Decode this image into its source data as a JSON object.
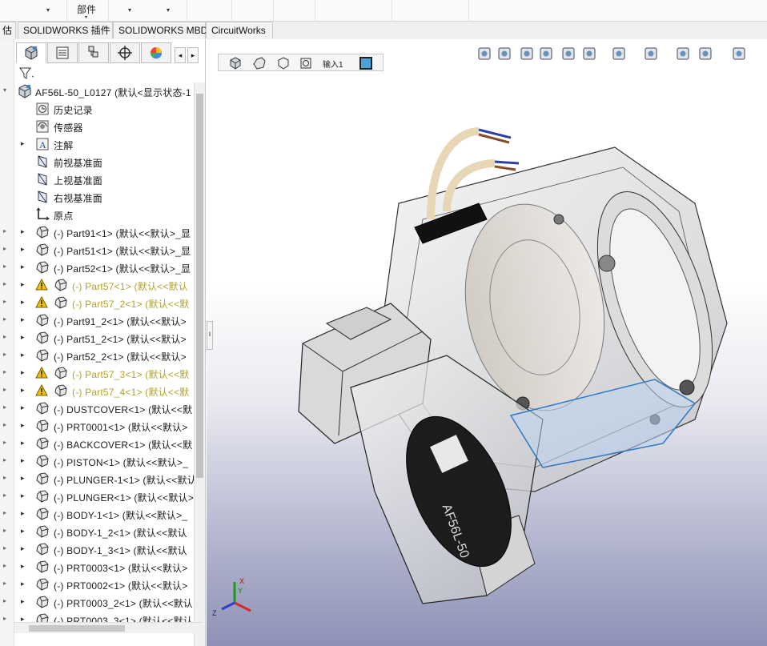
{
  "ribbon": {
    "groups": [
      {
        "label": "",
        "caret": "▾"
      },
      {
        "label": "部件",
        "caret": "▾"
      },
      {
        "label": "",
        "caret": "▾"
      },
      {
        "label": "",
        "caret": ""
      },
      {
        "label": "",
        "caret": ""
      },
      {
        "label": "",
        "caret": ""
      },
      {
        "label": "",
        "caret": ""
      },
      {
        "label": "",
        "caret": ""
      }
    ]
  },
  "tabs": [
    {
      "label": "估"
    },
    {
      "label": "SOLIDWORKS 插件"
    },
    {
      "label": "SOLIDWORKS MBD"
    },
    {
      "label": "CircuitWorks"
    }
  ],
  "panel_tabs": [
    {
      "icon": "feature-manager-icon"
    },
    {
      "icon": "property-manager-icon"
    },
    {
      "icon": "configuration-manager-icon"
    },
    {
      "icon": "dimxpert-icon"
    },
    {
      "icon": "display-manager-icon"
    }
  ],
  "tree": {
    "root": "AF56L-50_L0127  (默认<显示状态-1",
    "fixed_items": [
      {
        "label": "历史记录",
        "icon": "history-icon"
      },
      {
        "label": "传感器",
        "icon": "sensor-icon"
      },
      {
        "label": "注解",
        "icon": "annotation-icon"
      },
      {
        "label": "前视基准面",
        "icon": "plane-icon"
      },
      {
        "label": "上视基准面",
        "icon": "plane-icon"
      },
      {
        "label": "右视基准面",
        "icon": "plane-icon"
      },
      {
        "label": "原点",
        "icon": "origin-icon"
      }
    ],
    "parts": [
      {
        "label": "(-) Part91<1> (默认<<默认>_显",
        "warning": false
      },
      {
        "label": "(-) Part51<1> (默认<<默认>_显",
        "warning": false
      },
      {
        "label": "(-) Part52<1> (默认<<默认>_显",
        "warning": false
      },
      {
        "label": "(-) Part57<1> (默认<<默认",
        "warning": true
      },
      {
        "label": "(-) Part57_2<1> (默认<<默",
        "warning": true
      },
      {
        "label": "(-) Part91_2<1> (默认<<默认>",
        "warning": false
      },
      {
        "label": "(-) Part51_2<1> (默认<<默认>",
        "warning": false
      },
      {
        "label": "(-) Part52_2<1> (默认<<默认>",
        "warning": false
      },
      {
        "label": "(-) Part57_3<1> (默认<<默",
        "warning": true
      },
      {
        "label": "(-) Part57_4<1> (默认<<默",
        "warning": true
      },
      {
        "label": "(-) DUSTCOVER<1> (默认<<默",
        "warning": false
      },
      {
        "label": "(-) PRT0001<1> (默认<<默认>",
        "warning": false
      },
      {
        "label": "(-) BACKCOVER<1> (默认<<默",
        "warning": false
      },
      {
        "label": "(-) PISTON<1> (默认<<默认>_",
        "warning": false
      },
      {
        "label": "(-) PLUNGER-1<1> (默认<<默认",
        "warning": false
      },
      {
        "label": "(-) PLUNGER<1> (默认<<默认>",
        "warning": false
      },
      {
        "label": "(-) BODY-1<1> (默认<<默认>_",
        "warning": false
      },
      {
        "label": "(-) BODY-1_2<1> (默认<<默认",
        "warning": false
      },
      {
        "label": "(-) BODY-1_3<1> (默认<<默认",
        "warning": false
      },
      {
        "label": "(-) PRT0003<1> (默认<<默认>",
        "warning": false
      },
      {
        "label": "(-) PRT0002<1> (默认<<默认>",
        "warning": false
      },
      {
        "label": "(-) PRT0003_2<1> (默认<<默认",
        "warning": false
      },
      {
        "label": "(-) PRT0003_3<1> (默认<<默认",
        "warning": false
      }
    ]
  },
  "breadcrumb": {
    "label": "输入1",
    "icons": [
      "assembly-icon",
      "subassembly-icon",
      "part-icon",
      "feature-icon",
      "face-icon"
    ]
  },
  "hud_icons": [
    "zoom-to-fit-icon",
    "zoom-to-area-icon",
    "previous-view-icon",
    "section-view-icon",
    "dynamic-annotation-icon",
    "view-orientation-icon",
    "display-style-icon",
    "hide-show-icon",
    "edit-appearance-icon",
    "apply-scene-icon",
    "view-settings-icon"
  ],
  "model": {
    "label_text": "AF56L-50"
  },
  "triad": {
    "x": "X",
    "y": "Y",
    "z": "Z"
  },
  "colors": {
    "accent": "#4aa3d6",
    "warning_text": "#b2a22d",
    "warning_icon": "#f2c200"
  }
}
